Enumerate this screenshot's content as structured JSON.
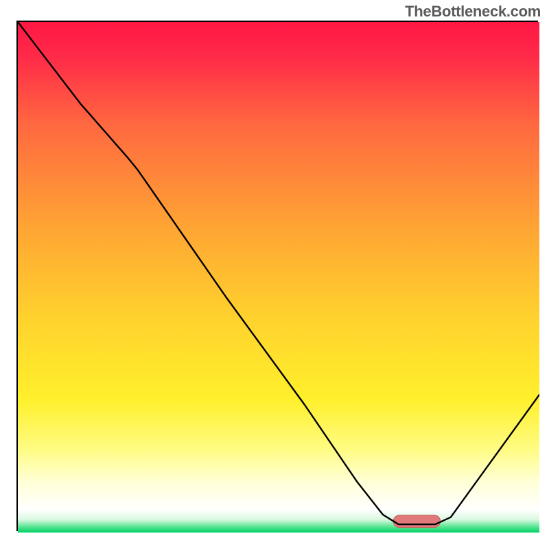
{
  "watermark": "TheBottleneck.com",
  "chart_data": {
    "type": "line",
    "xlabel": "",
    "ylabel": "",
    "xlim": [
      0,
      100
    ],
    "ylim": [
      0,
      100
    ],
    "grid": false,
    "legend": false,
    "gradient": {
      "stops": [
        {
          "offset": 0,
          "color": "#ff1744"
        },
        {
          "offset": 0.07,
          "color": "#ff2b48"
        },
        {
          "offset": 0.2,
          "color": "#ff6840"
        },
        {
          "offset": 0.4,
          "color": "#ffa434"
        },
        {
          "offset": 0.58,
          "color": "#ffd22d"
        },
        {
          "offset": 0.74,
          "color": "#fff02c"
        },
        {
          "offset": 0.84,
          "color": "#fffc86"
        },
        {
          "offset": 0.9,
          "color": "#ffffd6"
        },
        {
          "offset": 0.955,
          "color": "#ffffff"
        },
        {
          "offset": 0.975,
          "color": "#d8f8e0"
        },
        {
          "offset": 0.99,
          "color": "#4de38a"
        },
        {
          "offset": 1.0,
          "color": "#00d066"
        }
      ]
    },
    "series": [
      {
        "name": "curve",
        "color": "#000000",
        "width": 2.4,
        "points": [
          {
            "x": 0,
            "y": 100
          },
          {
            "x": 12,
            "y": 84
          },
          {
            "x": 21,
            "y": 73.5
          },
          {
            "x": 23,
            "y": 71
          },
          {
            "x": 40,
            "y": 46
          },
          {
            "x": 55,
            "y": 25
          },
          {
            "x": 65,
            "y": 10
          },
          {
            "x": 70,
            "y": 3.5
          },
          {
            "x": 73,
            "y": 1.6
          },
          {
            "x": 80,
            "y": 1.6
          },
          {
            "x": 83,
            "y": 3
          },
          {
            "x": 100,
            "y": 27
          }
        ]
      }
    ],
    "marker": {
      "color": "#e07a7a",
      "stroke": "#c86060",
      "x0": 72,
      "x1": 81,
      "y": 2.2,
      "rx": 1.2,
      "height": 2.4
    }
  }
}
